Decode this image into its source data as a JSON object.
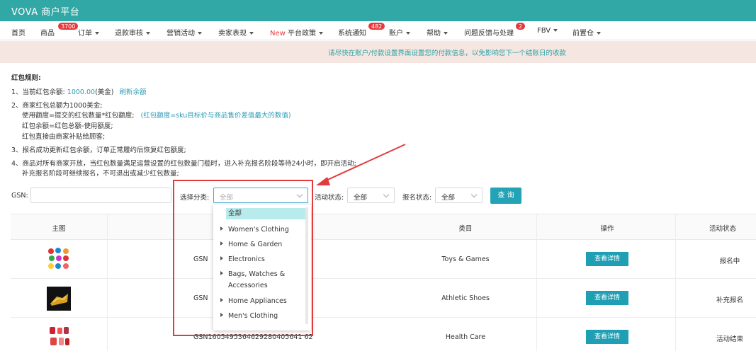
{
  "app": {
    "brand": "VOVA 商户平台"
  },
  "nav": [
    {
      "label": "首页",
      "caret": false
    },
    {
      "label": "商品",
      "caret": false,
      "badge": "3700"
    },
    {
      "label": "订单",
      "caret": true
    },
    {
      "label": "退款审核",
      "caret": true
    },
    {
      "label": "营销活动",
      "caret": true
    },
    {
      "label": "卖家表现",
      "caret": true
    },
    {
      "label_new": "New",
      "label": "平台政策",
      "caret": true
    },
    {
      "label": "系统通知",
      "caret": false,
      "badge": "482"
    },
    {
      "label": "账户",
      "caret": true
    },
    {
      "label": "帮助",
      "caret": true
    },
    {
      "label": "问题反馈与处理",
      "caret": false,
      "badge": "2"
    },
    {
      "label": "FBV",
      "caret": true
    },
    {
      "label": "前置仓",
      "caret": true
    }
  ],
  "notice": "请尽快在账户/付款设置界面设置您的付款信息，以免影响您下一个结账日的收款",
  "rules": {
    "title": "红包规则:",
    "l1_prefix": "1、当前红包余额:",
    "l1_amount": "1000.00",
    "l1_unit": "(美金)",
    "l1_link": "刷新余额",
    "l2": "2、商家红包总额为1000美金;",
    "l3": "使用额度=提交的红包数量*红包额度;",
    "l3_note": "(红包额度=sku目标价与商品售价差值最大的数值)",
    "l4": "红包余额=红包总额-使用额度;",
    "l5": "红包直接由商家补贴给顾客;",
    "l6": "3、报名成功更新红包余额，订单正常履约后恢复红包额度;",
    "l7": "4、商品对所有商家开放，当红包数量满足运营设置的红包数量门槛时，进入补充报名阶段等待24小时，即开启活动;",
    "l8": "补充报名阶段可继续报名，不可退出或减少红包数量;"
  },
  "filter": {
    "gsn_label": "GSN:",
    "category_label": "选择分类:",
    "category_placeholder": "全部",
    "activity_label": "活动状态:",
    "activity_value": "全部",
    "signup_label": "报名状态:",
    "signup_value": "全部",
    "query_button": "查 询"
  },
  "table": {
    "headers": {
      "image": "主图",
      "category": "类目",
      "action": "操作",
      "status": "活动状态"
    },
    "rows": [
      {
        "gsn": "GSN",
        "category": "Toys & Games",
        "action": "查看详情",
        "status": "报名中"
      },
      {
        "gsn": "GSN",
        "category": "Athletic Shoes",
        "action": "查看详情",
        "status": "补充报名"
      },
      {
        "gsn": "GSN1605495364629280405641 62",
        "category": "Health Care",
        "action": "查看详情",
        "status": "活动结束"
      }
    ]
  },
  "dropdown": {
    "all": "全部",
    "items": [
      "Women's Clothing",
      "Home & Garden",
      "Electronics",
      "Bags, Watches &",
      "Accessories",
      "Home Appliances",
      "Men's Clothing"
    ]
  },
  "colors": {
    "header": "#31a8a6",
    "accent": "#23a3b5",
    "badge": "#e5393c",
    "highlight": "#e23b3b"
  }
}
